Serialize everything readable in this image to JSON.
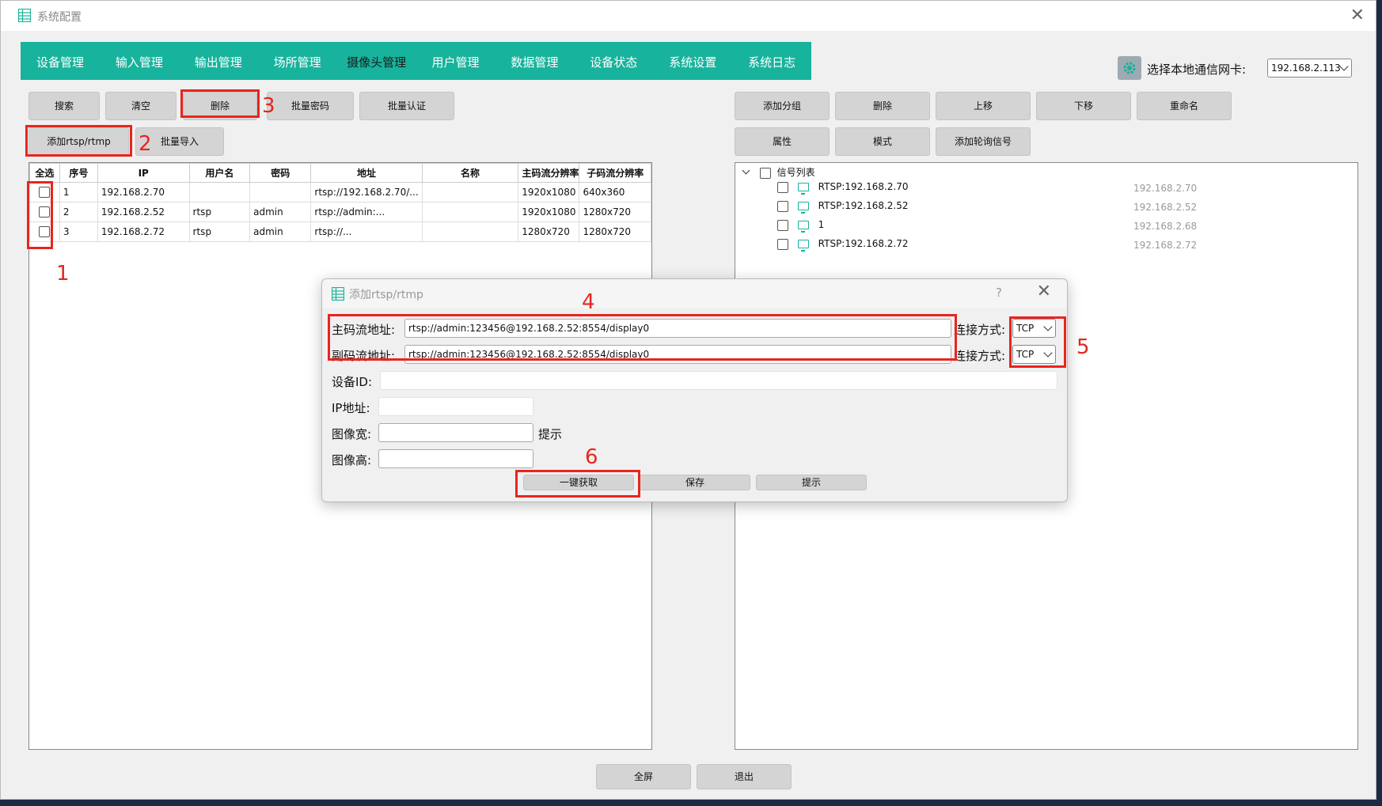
{
  "window": {
    "title": "系统配置"
  },
  "nav": [
    "设备管理",
    "输入管理",
    "输出管理",
    "场所管理",
    "摄像头管理",
    "用户管理",
    "数据管理",
    "设备状态",
    "系统设置",
    "系统日志"
  ],
  "nic": {
    "label": "选择本地通信网卡:",
    "value": "192.168.2.113"
  },
  "left_toolbar": {
    "search": "搜索",
    "clear": "清空",
    "delete": "删除",
    "batch_password": "批量密码",
    "batch_auth": "批量认证",
    "add_rtsp": "添加rtsp/rtmp",
    "batch_import": "批量导入"
  },
  "right_toolbar": {
    "add_group": "添加分组",
    "delete": "删除",
    "move_up": "上移",
    "move_down": "下移",
    "rename": "重命名",
    "property": "属性",
    "mode": "模式",
    "add_poll": "添加轮询信号"
  },
  "table": {
    "headers": [
      "全选",
      "序号",
      "IP",
      "用户名",
      "密码",
      "地址",
      "名称",
      "主码流分辨率",
      "子码流分辨率"
    ],
    "rows": [
      [
        "1",
        "192.168.2.70",
        "",
        "",
        "rtsp://192.168.2.70/...",
        "",
        "1920x1080",
        "640x360"
      ],
      [
        "2",
        "192.168.2.52",
        "rtsp",
        "admin",
        "rtsp://admin:...",
        "",
        "1920x1080",
        "1280x720"
      ],
      [
        "3",
        "192.168.2.72",
        "rtsp",
        "admin",
        "rtsp://...",
        "",
        "1280x720",
        "1280x720"
      ]
    ]
  },
  "tree": {
    "root": "信号列表",
    "items": [
      {
        "label": "RTSP:192.168.2.70",
        "ip": "192.168.2.70"
      },
      {
        "label": "RTSP:192.168.2.52",
        "ip": "192.168.2.52"
      },
      {
        "label": "1",
        "ip": "192.168.2.68"
      },
      {
        "label": "RTSP:192.168.2.72",
        "ip": "192.168.2.72"
      }
    ]
  },
  "dialog": {
    "title": "添加rtsp/rtmp",
    "help": "?",
    "main_label": "主码流地址:",
    "main_value": "rtsp://admin:123456@192.168.2.52:8554/display0",
    "sub_label": "副码流地址:",
    "sub_value": "rtsp://admin:123456@192.168.2.52:8554/display0",
    "conn_label": "连接方式:",
    "conn_value": "TCP",
    "device_id_label": "设备ID:",
    "ip_label": "IP地址:",
    "width_label": "图像宽:",
    "height_label": "图像高:",
    "hint_label": "提示",
    "fetch_button": "一键获取",
    "save_button": "保存",
    "hint_button": "提示"
  },
  "bottom": {
    "fullscreen": "全屏",
    "exit": "退出"
  },
  "annotations": [
    "1",
    "2",
    "3",
    "4",
    "5",
    "6"
  ],
  "colors": {
    "accent": "#17b39d",
    "annotation": "#e8251f"
  }
}
